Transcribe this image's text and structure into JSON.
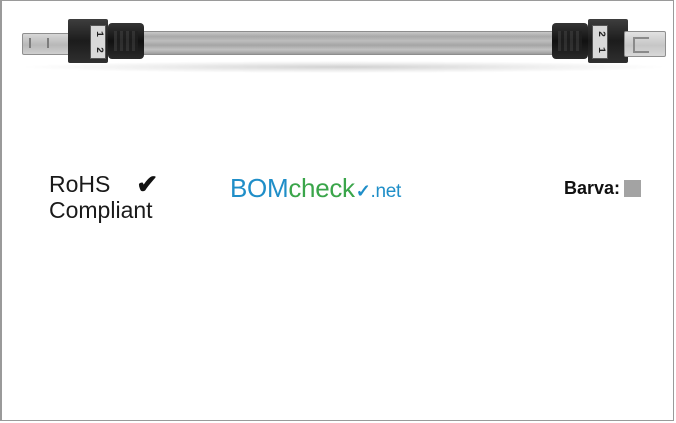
{
  "product_image": {
    "left_pin_labels": [
      "1",
      "2"
    ],
    "right_pin_labels": [
      "2",
      "1"
    ],
    "cable_color": "#b3b3b3",
    "connector_color": "#1e1e1e"
  },
  "compliance": {
    "rohs_line1": "RoHS",
    "rohs_check": "✔",
    "rohs_line2": "Compliant"
  },
  "bomcheck": {
    "part1": "BOM",
    "part2": "check",
    "check_glyph": "✓",
    "part3": ".net"
  },
  "color_info": {
    "label": "Barva:",
    "swatch_color": "#a3a3a3"
  }
}
